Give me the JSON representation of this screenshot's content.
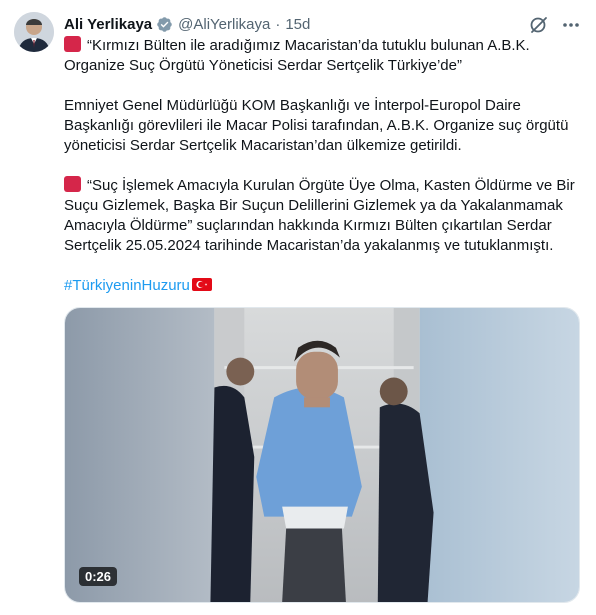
{
  "author": {
    "name": "Ali Yerlikaya",
    "handle": "@AliYerlikaya",
    "separator": "·",
    "time": "15d"
  },
  "tweet": {
    "p1": "“Kırmızı Bülten ile aradığımız Macaristan’da tutuklu bulunan A.B.K. Organize Suç Örgütü Yöneticisi Serdar Sertçelik Türkiye’de”",
    "p2": "Emniyet Genel Müdürlüğü KOM Başkanlığı ve İnterpol-Europol Daire Başkanlığı görevlileri ile Macar Polisi tarafından, A.B.K. Organize suç örgütü yöneticisi Serdar Sertçelik Macaristan’dan ülkemize getirildi.",
    "p3": "“Suç İşlemek Amacıyla Kurulan Örgüte Üye Olma, Kasten Öldürme ve Bir Suçu Gizlemek, Başka Bir Suçun Delillerini Gizlemek ya da Yakalanmamak Amacıyla Öldürme” suçlarından hakkında Kırmızı Bülten çıkartılan Serdar Sertçelik 25.05.2024 tarihinde Macaristan’da yakalanmış ve tutuklanmıştı.",
    "hashtag": "#TürkiyeninHuzuru"
  },
  "media": {
    "duration": "0:26"
  },
  "icons": {
    "verified": "verified-badge-icon",
    "grok": "grok-icon",
    "more": "more-options-icon",
    "red_square": "red-square-emoji",
    "flag": "turkey-flag-emoji"
  },
  "colors": {
    "accent": "#1d9bf0",
    "muted": "#536471",
    "red_square": "#d5264a"
  }
}
